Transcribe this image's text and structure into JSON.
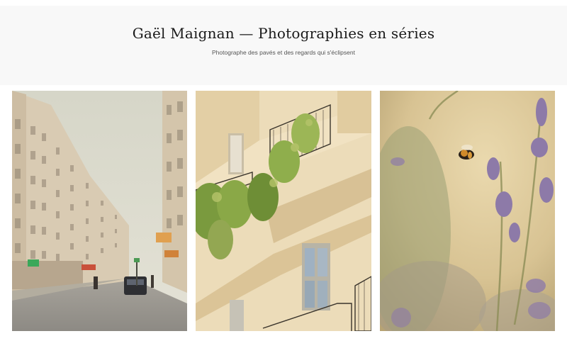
{
  "header": {
    "title": "Gaël Maignan — Photographies en séries",
    "tagline": "Photographe des pavés et des regards qui s'éclipsent"
  },
  "gallery": {
    "photos": [
      {
        "subject": "street-photo"
      },
      {
        "subject": "building-facade-photo"
      },
      {
        "subject": "bee-lavender-photo"
      }
    ]
  },
  "colors": {
    "header_bg": "#f8f8f8",
    "title": "#1a1a1a",
    "tagline": "#555555"
  }
}
